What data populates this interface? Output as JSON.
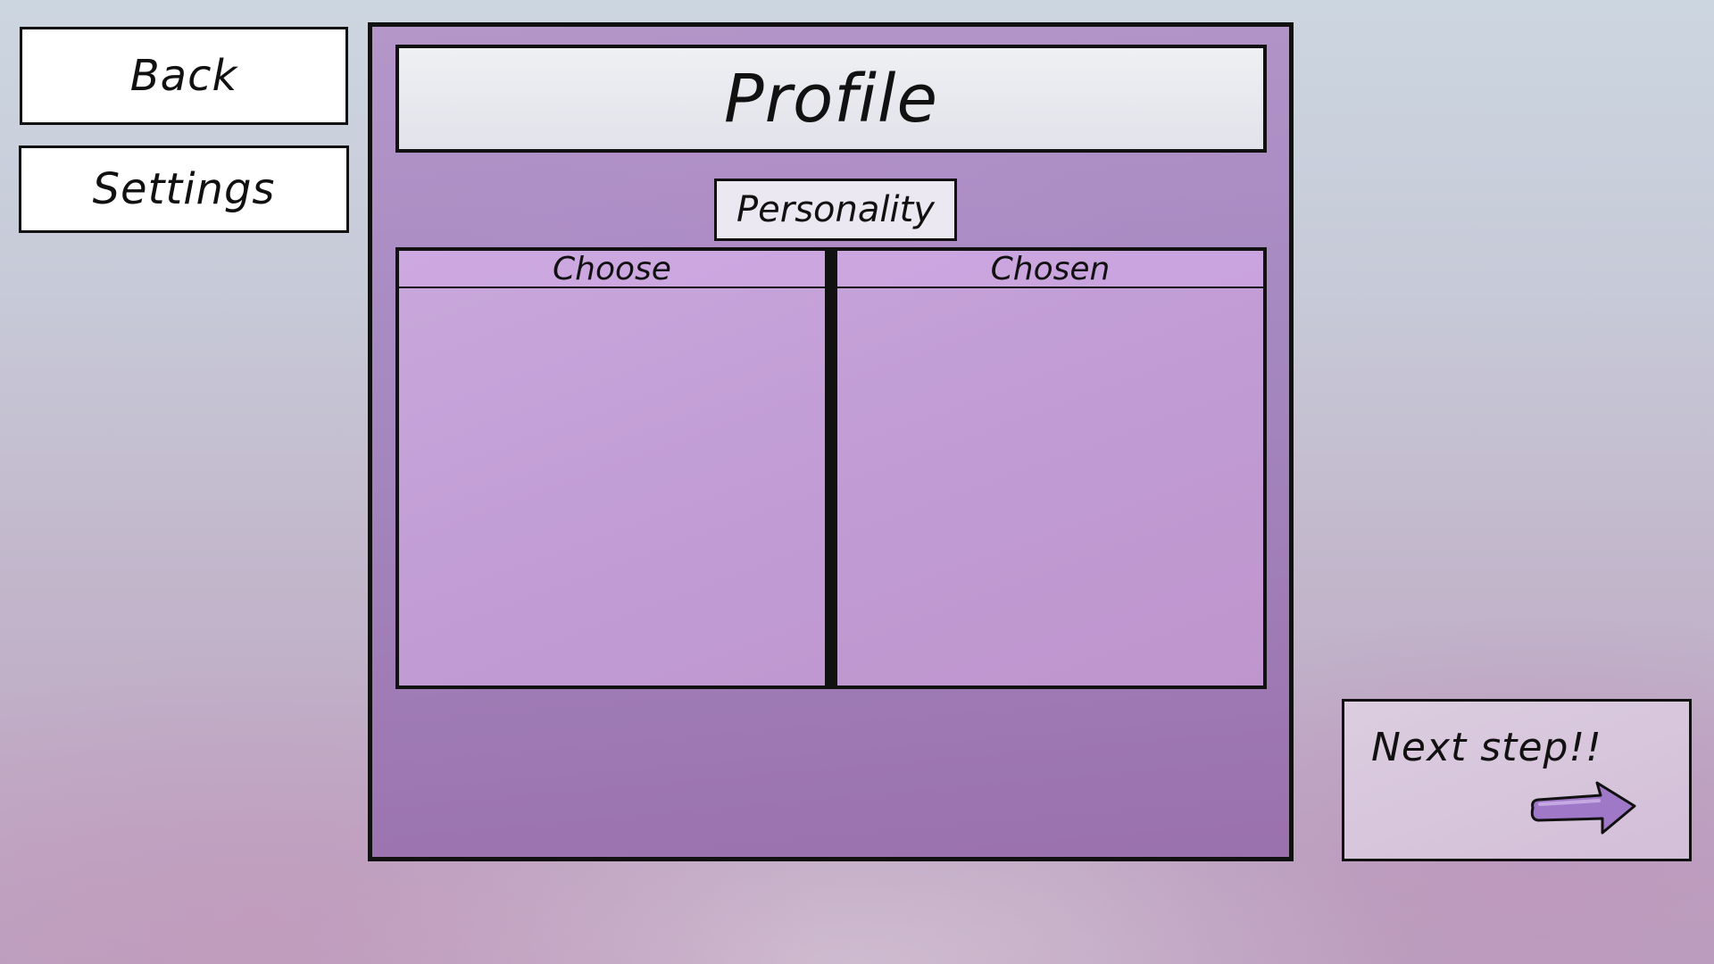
{
  "nav": {
    "back_label": "Back",
    "settings_label": "Settings"
  },
  "panel": {
    "title": "Profile",
    "tab_label": "Personality",
    "lists": {
      "left_header": "Choose",
      "right_header": "Chosen",
      "left_items": [],
      "right_items": []
    }
  },
  "next": {
    "label": "Next step!!",
    "icon": "right-arrow-icon"
  },
  "colors": {
    "panel": "#a689c1",
    "list_fill": "#c19cd5",
    "arrow": "#9f78c8"
  }
}
